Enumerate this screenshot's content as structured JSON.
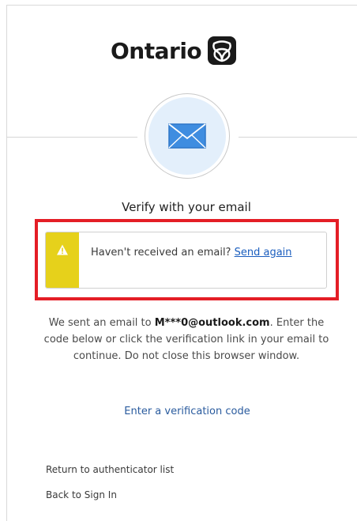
{
  "brand": {
    "name": "Ontario",
    "logo_icon": "trillium-logo-icon"
  },
  "badge": {
    "icon": "envelope-icon",
    "accent": "#e3effb"
  },
  "title": "Verify with your email",
  "alert": {
    "icon": "warning-icon",
    "bar_color": "#e6d11b",
    "text": "Haven't received an email?",
    "link_label": "Send again"
  },
  "message": {
    "prefix": "We sent an email to ",
    "email": "M***0@outlook.com",
    "suffix": ". Enter the code below or click the verification link in your email to continue. Do not close this browser window."
  },
  "actions": {
    "enter_code": "Enter a verification code",
    "return_to_list": "Return to authenticator list",
    "back_to_sign_in": "Back to Sign In"
  },
  "colors": {
    "highlight_frame": "#e41e26",
    "link": "#1a5dbe"
  }
}
